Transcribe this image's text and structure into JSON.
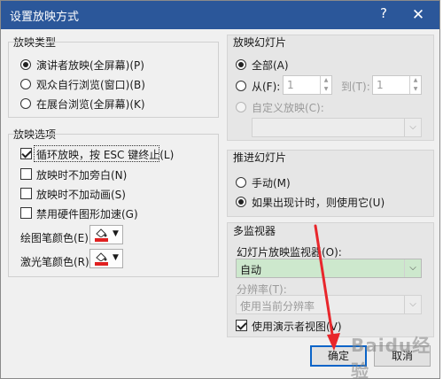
{
  "dialog": {
    "title": "设置放映方式",
    "help": "?",
    "close": "✕"
  },
  "show_type": {
    "title": "放映类型",
    "options": [
      {
        "label": "演讲者放映(全屏幕)(P)",
        "selected": true
      },
      {
        "label": "观众自行浏览(窗口)(B)",
        "selected": false
      },
      {
        "label": "在展台浏览(全屏幕)(K)",
        "selected": false
      }
    ]
  },
  "show_options": {
    "title": "放映选项",
    "items": [
      {
        "label": "循环放映，按 ESC 键终止(L)",
        "checked": true
      },
      {
        "label": "放映时不加旁白(N)",
        "checked": false
      },
      {
        "label": "放映时不加动画(S)",
        "checked": false
      },
      {
        "label": "禁用硬件图形加速(G)",
        "checked": false
      }
    ],
    "pen_color_label": "绘图笔颜色(E):",
    "laser_color_label": "激光笔颜色(R):",
    "pen_color": "#e02020",
    "laser_color": "#e02020"
  },
  "slides": {
    "title": "放映幻灯片",
    "all_label": "全部(A)",
    "from_label": "从(F):",
    "from_value": "1",
    "to_label": "到(T):",
    "to_value": "1",
    "custom_label": "自定义放映(C):",
    "custom_value": ""
  },
  "advance": {
    "title": "推进幻灯片",
    "manual_label": "手动(M)",
    "timing_label": "如果出现计时，则使用它(U)"
  },
  "monitors": {
    "title": "多监视器",
    "monitor_label": "幻灯片放映监视器(O):",
    "monitor_value": "自动",
    "resolution_label": "分辨率(T):",
    "resolution_value": "使用当前分辨率",
    "presenter_view_label": "使用演示者视图(V)",
    "presenter_view_checked": true
  },
  "buttons": {
    "ok": "确定",
    "cancel": "取消"
  },
  "colors": {
    "titlebar": "#2b579a",
    "default_button_border": "#0a64c8",
    "selected_combo": "#cde8cd",
    "annotation_arrow": "#e8262b"
  }
}
